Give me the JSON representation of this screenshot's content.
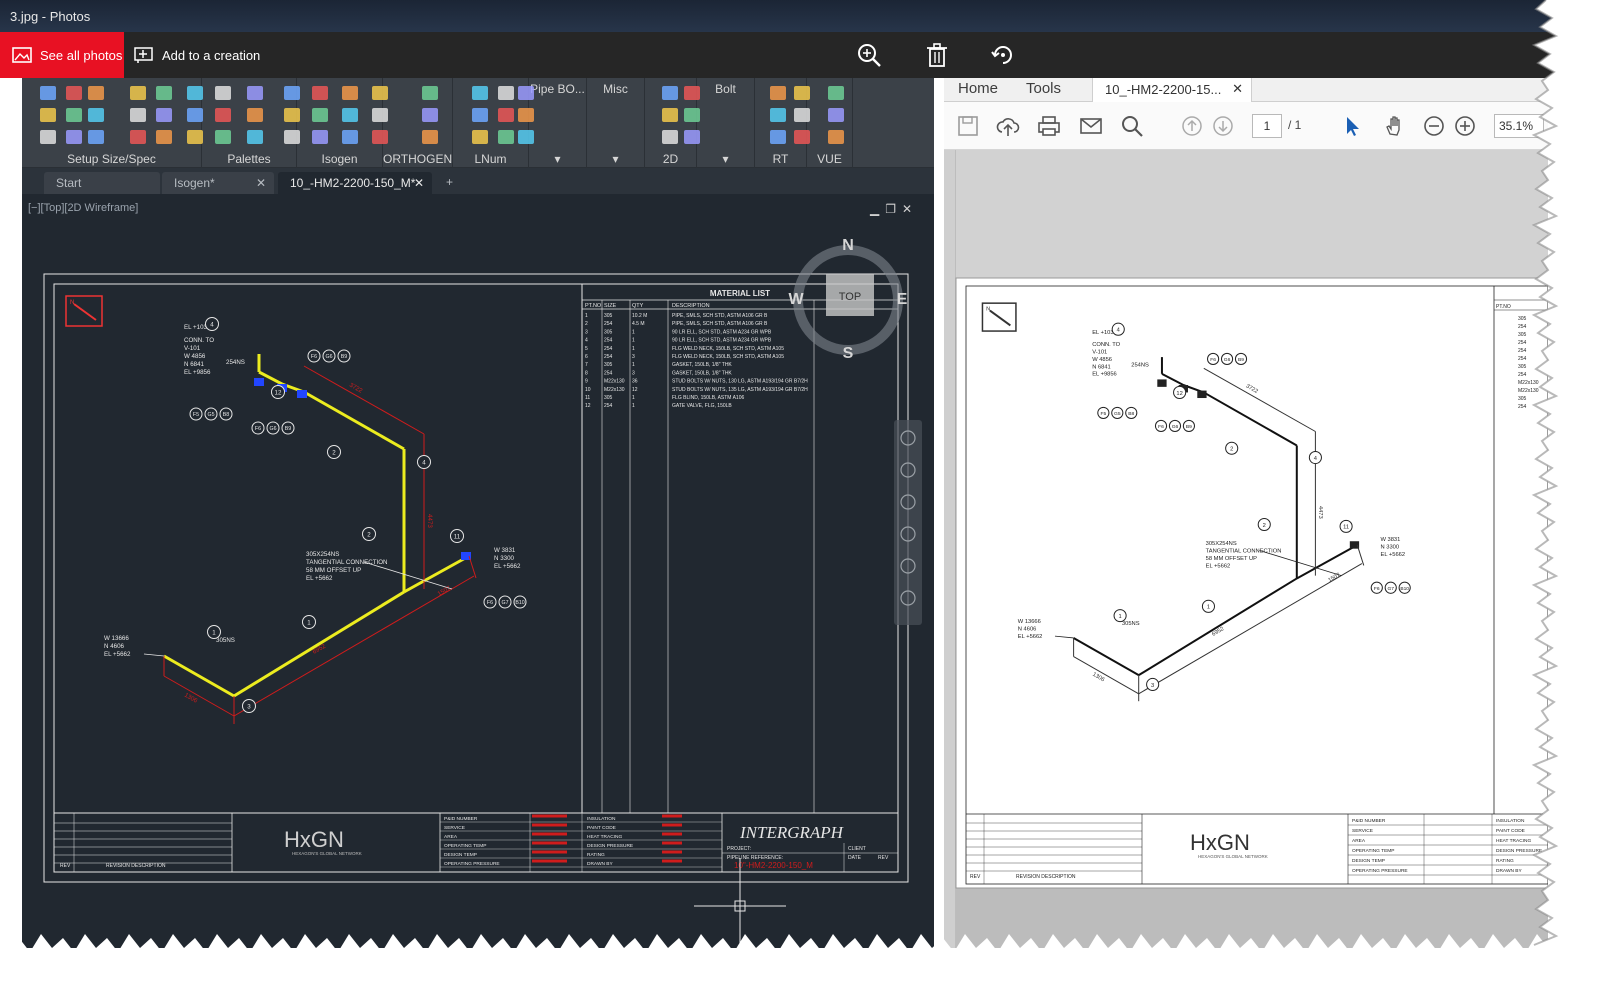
{
  "photos": {
    "title": "3.jpg - Photos",
    "see_all_label": "See all photos",
    "add_creation_label": "Add to a creation"
  },
  "cad": {
    "ribbon_groups": [
      {
        "label": "Setup Size/Spec"
      },
      {
        "label": "Palettes"
      },
      {
        "label": "Isogen"
      },
      {
        "label": "ORTHOGEN"
      },
      {
        "label": "LNum"
      },
      {
        "label": "Pipe BO..."
      },
      {
        "label": "Misc"
      },
      {
        "label": "2D"
      },
      {
        "label": "Bolt"
      },
      {
        "label": "RT"
      },
      {
        "label": "VUE"
      }
    ],
    "tabs": [
      {
        "label": "Start"
      },
      {
        "label": "Isogen*"
      },
      {
        "label": "10_-HM2-2200-150_M*"
      }
    ],
    "viewport_label": "[−][Top][2D Wireframe]",
    "viewcube": {
      "north": "N",
      "south": "S",
      "east": "E",
      "west": "W",
      "top": "TOP"
    },
    "drawing": {
      "material_list_title": "MATERIAL LIST",
      "headers": [
        "PT.NO",
        "SIZE",
        "QTY",
        "DESCRIPTION"
      ],
      "rows": [
        {
          "pt": "1",
          "size": "305",
          "qty": "10.2 M",
          "desc": "PIPE, SMLS, SCH STD, ASTM A106 GR B"
        },
        {
          "pt": "2",
          "size": "254",
          "qty": "4.5 M",
          "desc": "PIPE, SMLS, SCH STD, ASTM A106 GR B"
        },
        {
          "pt": "3",
          "size": "305",
          "qty": "1",
          "desc": "90 LR ELL, SCH STD, ASTM A234 GR WPB"
        },
        {
          "pt": "4",
          "size": "254",
          "qty": "1",
          "desc": "90 LR ELL, SCH STD, ASTM A234 GR WPB"
        },
        {
          "pt": "5",
          "size": "254",
          "qty": "1",
          "desc": "FLG WELD NECK, 150LB, SCH STD, ASTM A105"
        },
        {
          "pt": "6",
          "size": "254",
          "qty": "3",
          "desc": "FLG WELD NECK, 150LB, SCH STD, ASTM A105"
        },
        {
          "pt": "7",
          "size": "305",
          "qty": "1",
          "desc": "GASKET, 150LB, 1/8\" THK"
        },
        {
          "pt": "8",
          "size": "254",
          "qty": "3",
          "desc": "GASKET, 150LB, 1/8\" THK"
        },
        {
          "pt": "9",
          "size": "M22x130",
          "qty": "36",
          "desc": "STUD BOLTS W/ NUTS, 130 LG, ASTM A193/194 GR B7/2H"
        },
        {
          "pt": "10",
          "size": "M22x130",
          "qty": "12",
          "desc": "STUD BOLTS W/ NUTS, 135 LG, ASTM A193/194 GR B7/2H"
        },
        {
          "pt": "11",
          "size": "305",
          "qty": "1",
          "desc": "FLG BLIND, 150LB, ASTM A106"
        },
        {
          "pt": "12",
          "size": "254",
          "qty": "1",
          "desc": "GATE VALVE, FLG, 150LB"
        }
      ],
      "labels": {
        "conn": "CONN. TO",
        "equip": "V-101",
        "w1": "W 4856",
        "n1": "N 6841",
        "el1": "EL +9856",
        "el_top": "EL +10342",
        "size_254": "254NS",
        "tangent1": "305X254NS",
        "tangent2": "TANGENTIAL CONNECTION",
        "tangent3": "58 MM OFFSET UP",
        "tangent4": "EL +5662",
        "w2": "W 13666",
        "n2": "N 4606",
        "el2": "EL +5662",
        "size_305": "305NS",
        "w3": "W 3831",
        "n3": "N 3300",
        "el3": "EL +5662",
        "dim1": "3722",
        "dim2": "4473",
        "dim3": "1507",
        "dim4": "6952",
        "dim5": "1306",
        "compass": "N"
      },
      "balloons": [
        "1",
        "2",
        "3",
        "4",
        "11",
        "12"
      ],
      "flag_refs": [
        "F6",
        "G6",
        "B9",
        "F5",
        "G5",
        "B8",
        "F6",
        "G7",
        "B10"
      ],
      "title_block": {
        "rev": "REV",
        "rev_desc": "REVISION DESCRIPTION",
        "logo": "HxGN",
        "logo_sub": "HEXAGON'S GLOBAL NETWORK",
        "fields": [
          "P&ID NUMBER",
          "SERVICE",
          "AREA",
          "OPERATING TEMP",
          "DESIGN TEMP",
          "OPERATING PRESSURE"
        ],
        "fields2": [
          "INSULATION",
          "PAINT CODE",
          "HEAT TRACING",
          "DESIGN PRESSURE",
          "RATING",
          "DRAWN BY"
        ],
        "brand": "INTERGRAPH",
        "project": "PROJECT:",
        "client": "CLIENT",
        "pipeline_ref": "PIPELINE REFERENCE:",
        "pipeline_num": "10\"-HM2-2200-150_M",
        "date": "DATE",
        "rev2": "REV"
      }
    }
  },
  "acrobat": {
    "tab_home": "Home",
    "tab_tools": "Tools",
    "doc_tab": "10_-HM2-2200-15...",
    "page_current": "1",
    "page_total": "/ 1",
    "zoom": "35.1%"
  },
  "colors": {
    "cad_bg": "#212830",
    "pipe": "#ecec1f",
    "dim": "#d01c1c",
    "line": "#e6e6e6",
    "photos_red": "#e81123"
  }
}
